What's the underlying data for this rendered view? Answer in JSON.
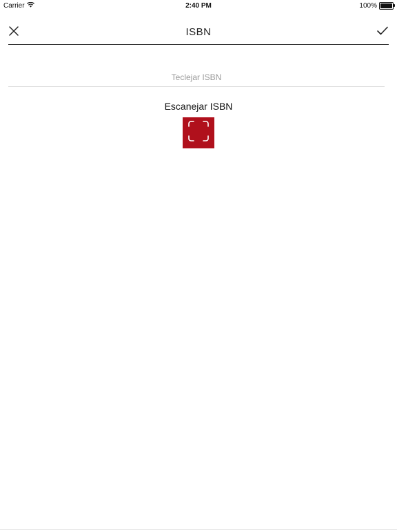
{
  "status_bar": {
    "carrier": "Carrier",
    "time": "2:40 PM",
    "battery": "100%",
    "battery_level": 1.0
  },
  "header": {
    "title": "ISBN",
    "close_icon": "close-icon",
    "confirm_icon": "checkmark-icon"
  },
  "isbn_field": {
    "value": "",
    "placeholder": "Teclejar ISBN"
  },
  "scan": {
    "label": "Escanejar ISBN",
    "icon": "scan-frame-icon",
    "button_color": "#b0101c"
  },
  "colors": {
    "accent": "#b0101c",
    "text": "#111111",
    "placeholder": "#9a9a9a",
    "divider": "#dddddd"
  }
}
